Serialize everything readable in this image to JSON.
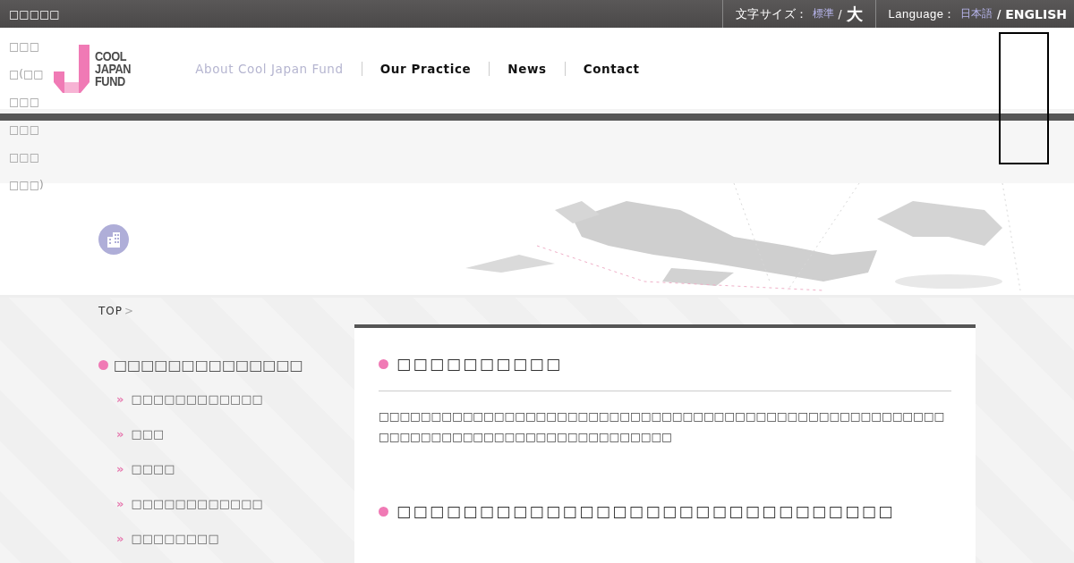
{
  "topbar": {
    "site_label": "□□□□□",
    "font_size": {
      "label": "文字サイズ：",
      "options": [
        {
          "label": "標準",
          "selected": true
        },
        {
          "label": "大",
          "selected": false
        }
      ],
      "separator": "/"
    },
    "language": {
      "label": "Language：",
      "options": [
        {
          "label": "日本語",
          "selected": true
        },
        {
          "label": "ENGLISH",
          "selected": false
        }
      ],
      "separator": "/"
    }
  },
  "overflow_text": "□□□□(□□□□□□□□□□□□□□)",
  "logo": {
    "text_lines": [
      "COOL",
      "JAPAN",
      "FUND"
    ]
  },
  "nav": [
    {
      "label": "About Cool Japan Fund",
      "selected": true
    },
    {
      "label": "Our Practice",
      "selected": false
    },
    {
      "label": "News",
      "selected": false
    },
    {
      "label": "Contact",
      "selected": false
    }
  ],
  "breadcrumb": {
    "items": [
      "TOP"
    ],
    "separator": ">"
  },
  "sidebar": {
    "marker": "»",
    "title": "□□□□□□□□□□□□□□",
    "items": [
      {
        "label": "□□□□□□□□□□□□"
      },
      {
        "label": "□□□"
      },
      {
        "label": "□□□□"
      },
      {
        "label": "□□□□□□□□□□□□"
      },
      {
        "label": "□□□□□□□□"
      }
    ]
  },
  "sections": [
    {
      "heading": "□□□□□□□□□□",
      "body": "□□□□□□□□□□□□□□□□□□□□□□□□□□□□□□□□□□□□□□□□□□□□□□□□□□□□□□□□□□□□□□□□□□□□□□□□□□□□□□□□□□"
    },
    {
      "heading": "□□□□□□□□□□□□□□□□□□□□□□□□□□□□□□"
    }
  ]
}
